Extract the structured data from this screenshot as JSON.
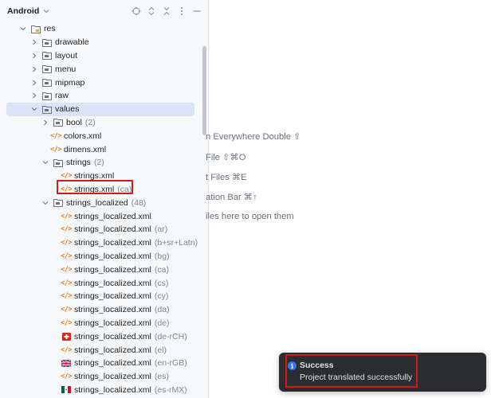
{
  "panel": {
    "title": "Android",
    "tools": [
      "crosshair-icon",
      "expand-icon",
      "collapse-icon",
      "more-icon",
      "minimize-icon"
    ]
  },
  "tree": {
    "res": "res",
    "drawable": "drawable",
    "layout": "layout",
    "menu": "menu",
    "mipmap": "mipmap",
    "raw": "raw",
    "values": "values",
    "bool": "bool",
    "bool_count": "(2)",
    "colors": "colors.xml",
    "dimens": "dimens.xml",
    "strings": "strings",
    "strings_count": "(2)",
    "strings_xml": "strings.xml",
    "strings_xml_ca": "strings.xml",
    "strings_xml_ca_suffix": "(ca)",
    "strings_localized": "strings_localized",
    "strings_localized_count": "(48)",
    "localized_name": "strings_localized.xml",
    "localized_items": [
      {
        "suffix": "",
        "icon": "xml"
      },
      {
        "suffix": "(ar)",
        "icon": "xml"
      },
      {
        "suffix": "(b+sr+Latn)",
        "icon": "xml"
      },
      {
        "suffix": "(bg)",
        "icon": "xml"
      },
      {
        "suffix": "(ca)",
        "icon": "xml"
      },
      {
        "suffix": "(cs)",
        "icon": "xml"
      },
      {
        "suffix": "(cy)",
        "icon": "xml"
      },
      {
        "suffix": "(da)",
        "icon": "xml"
      },
      {
        "suffix": "(de)",
        "icon": "xml"
      },
      {
        "suffix": "(de-rCH)",
        "icon": "flag-ch"
      },
      {
        "suffix": "(el)",
        "icon": "xml"
      },
      {
        "suffix": "(en-rGB)",
        "icon": "flag-gb"
      },
      {
        "suffix": "(es)",
        "icon": "xml"
      },
      {
        "suffix": "(es-rMX)",
        "icon": "flag-mx"
      }
    ]
  },
  "editor": {
    "hints": [
      "n Everywhere Double ⇧",
      "File ⇧⌘O",
      "t Files ⌘E",
      "ation Bar ⌘↑",
      "iles here to open them"
    ]
  },
  "notification": {
    "title": "Success",
    "message": "Project translated successfully",
    "accent": "#3574f0"
  },
  "colors": {
    "highlight": "#d01a1a",
    "selection": "#dbe3f9",
    "xml_icon": "#e07b1b"
  }
}
